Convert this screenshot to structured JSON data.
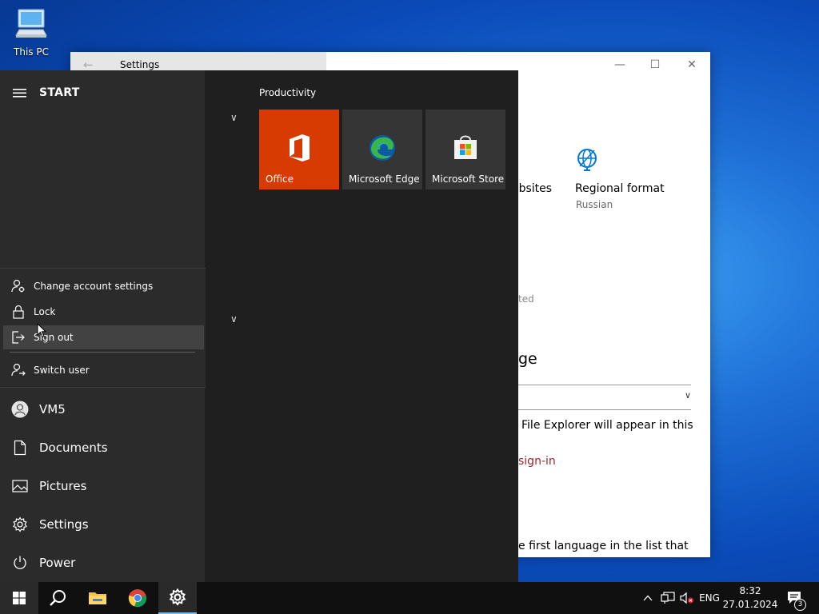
{
  "desktop": {
    "icon_label": "This PC"
  },
  "settings_window": {
    "title": "Settings",
    "frag_websites": "ebsites",
    "regional_format_label": "Regional format",
    "regional_format_value": "Russian",
    "frag_ated": "ted",
    "frag_ge": "ge",
    "frag_chevron": "∨",
    "frag_file_explorer": "File Explorer will appear in this",
    "frag_signin": "sign-in",
    "frag_first_language": "e first language in the list that"
  },
  "start_menu": {
    "title": "START",
    "account_menu": [
      {
        "label": "Change account settings",
        "icon": "person-gear-icon"
      },
      {
        "label": "Lock",
        "icon": "lock-icon"
      },
      {
        "label": "Sign out",
        "icon": "sign-out-icon"
      },
      {
        "label": "Switch user",
        "icon": "switch-user-icon"
      }
    ],
    "nav": [
      {
        "label": "VM5",
        "icon": "avatar"
      },
      {
        "label": "Documents",
        "icon": "document-icon"
      },
      {
        "label": "Pictures",
        "icon": "pictures-icon"
      },
      {
        "label": "Settings",
        "icon": "gear-icon"
      },
      {
        "label": "Power",
        "icon": "power-icon"
      }
    ],
    "group_title": "Productivity",
    "tiles": [
      {
        "label": "Office",
        "color": "#d83b01"
      },
      {
        "label": "Microsoft Edge",
        "color": "#353535"
      },
      {
        "label": "Microsoft Store",
        "color": "#353535"
      }
    ]
  },
  "taskbar": {
    "language": "ENG",
    "time": "8:32",
    "date": "27.01.2024",
    "notification_count": "3"
  }
}
